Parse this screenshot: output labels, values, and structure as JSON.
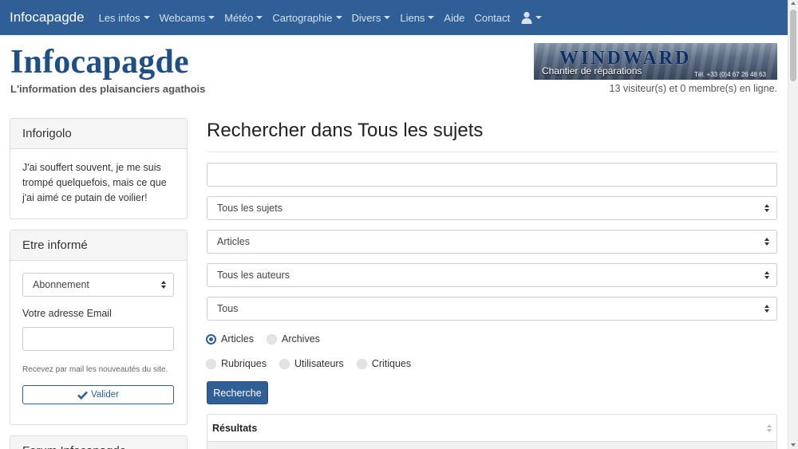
{
  "navbar": {
    "brand": "Infocapagde",
    "items": [
      {
        "label": "Les infos",
        "dropdown": true
      },
      {
        "label": "Webcams",
        "dropdown": true
      },
      {
        "label": "Météo",
        "dropdown": true
      },
      {
        "label": "Cartographie",
        "dropdown": true
      },
      {
        "label": "Divers",
        "dropdown": true
      },
      {
        "label": "Liens",
        "dropdown": true
      },
      {
        "label": "Aide",
        "dropdown": false
      },
      {
        "label": "Contact",
        "dropdown": false
      }
    ],
    "user_icon": "user-icon"
  },
  "header": {
    "title": "Infocapagde",
    "tagline": "L'information des plaisanciers agathois",
    "banner": {
      "logo": "WINDWARD",
      "subtitle": "Chantier de réparations",
      "phone": "Tél. +33 (0)4 67 26 48 63"
    },
    "visitors": "13 visiteur(s) et 0 membre(s) en ligne."
  },
  "sidebar": {
    "inforigolo": {
      "heading": "Inforigolo",
      "text": "J'ai souffert souvent, je me suis trompé quelquefois, mais ce que j'ai aimé ce putain de voilier!"
    },
    "subscribe": {
      "heading": "Etre informé",
      "select_value": "Abonnement",
      "email_label": "Votre adresse Email",
      "email_value": "",
      "help": "Recevez par mail les nouveautés du site.",
      "submit_label": "Valider"
    },
    "third_panel_heading": "Forum Infocapagde"
  },
  "main": {
    "title": "Rechercher dans Tous les sujets",
    "query_value": "",
    "selects": [
      "Tous les sujets",
      "Articles",
      "Tous les auteurs",
      "Tous"
    ],
    "radios_row1": [
      {
        "label": "Articles",
        "checked": true
      },
      {
        "label": "Archives",
        "checked": false
      }
    ],
    "radios_row2": [
      {
        "label": "Rubriques",
        "checked": false
      },
      {
        "label": "Utilisateurs",
        "checked": false
      },
      {
        "label": "Critiques",
        "checked": false
      }
    ],
    "search_button": "Recherche",
    "results_header": "Résultats"
  },
  "colors": {
    "navbar": "#2f5f96",
    "brand_title": "#1f4f83",
    "accent": "#2f5f96"
  }
}
